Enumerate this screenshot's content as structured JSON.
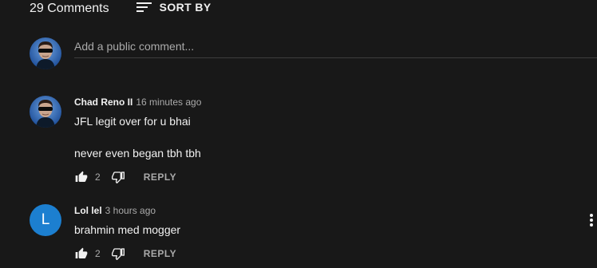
{
  "comments_header": {
    "count_text": "29 Comments",
    "sort_label": "SORT BY"
  },
  "add_comment": {
    "placeholder": "Add a public comment..."
  },
  "comments": [
    {
      "author": "Chad Reno II",
      "time": "16 minutes ago",
      "lines": [
        "JFL legit over for u bhai",
        "never even began tbh tbh"
      ],
      "likes": "2",
      "reply_label": "REPLY",
      "avatar_icon": "sunglasses-avatar-icon"
    },
    {
      "author": "Lol lel",
      "time": "3 hours ago",
      "lines": [
        "brahmin med mogger"
      ],
      "likes": "2",
      "reply_label": "REPLY",
      "avatar_letter": "L",
      "avatar_color": "#1c7fd0"
    }
  ],
  "colors": {
    "background": "#181818",
    "text": "#f1f1f1",
    "secondary_text": "#aaaaaa",
    "divider": "#3d3d3d"
  }
}
